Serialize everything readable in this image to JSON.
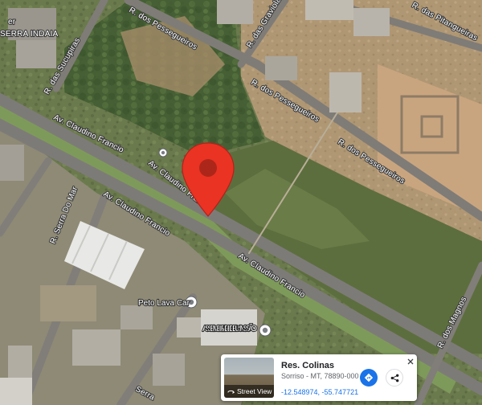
{
  "map": {
    "type": "satellite",
    "streets": {
      "claudino_upper": "Av. Claudino Francio",
      "claudino_mid": "Av. Claudino Francio",
      "claudino_lower_left": "Av. Claudino Francio",
      "claudino_lower_right": "Av. Claudino Francio",
      "pessegueiros_top": "R. dos Pessegueiros",
      "pessegueiros_mid": "R. dos Pessegueiros",
      "pessegueiros_right": "R. dos Pessegueiros",
      "graviolas": "R. das Graviolas",
      "pitangueiras": "R. das Pitangueiras",
      "sucupiras": "R. das Sucupiras",
      "serra_do_mar": "R. Serra Do Mar",
      "magnos": "R. dos Magnos",
      "serra_bottom": "Serra",
      "serra_indaia": "SERRA INDAIA",
      "top_left_fragment": "er"
    },
    "pois": {
      "lava_car": "Peto Lava Car",
      "assembleia": "ASSEMBLEIA DE DEUS MISSÃO"
    },
    "marker_color": "#ea3323"
  },
  "info_card": {
    "title": "Res. Colinas",
    "subtitle": "Sorriso - MT, 78890-000",
    "coords": "-12.548974, -55.747721",
    "street_view_label": "Street View",
    "directions_icon": "directions-icon",
    "share_icon": "share-icon",
    "close_icon": "close-icon"
  }
}
